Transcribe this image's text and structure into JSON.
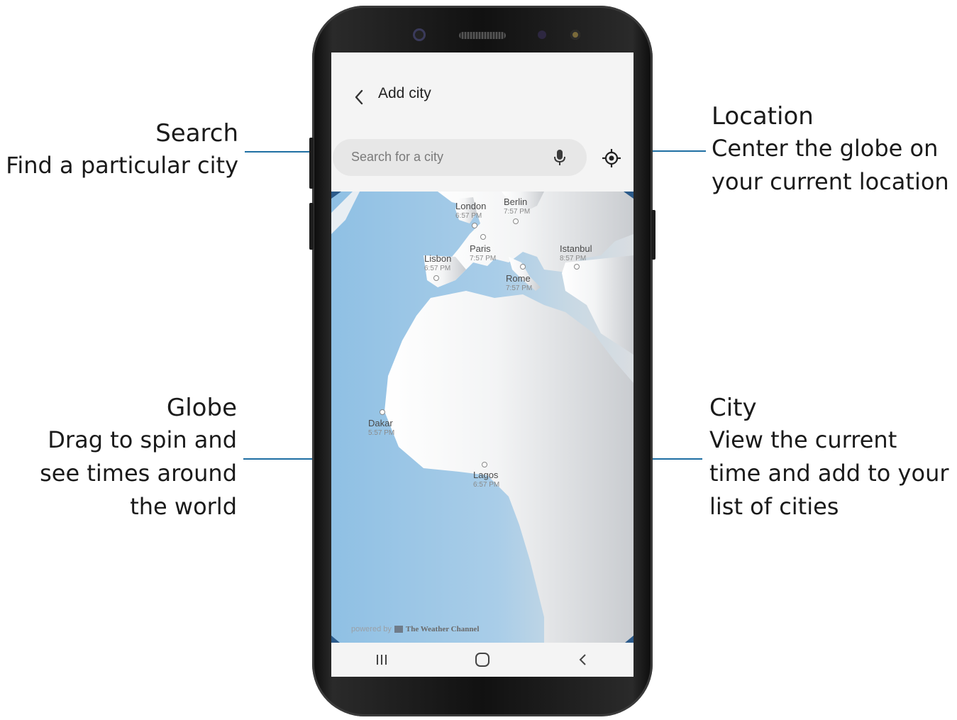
{
  "callouts": {
    "search": {
      "title": "Search",
      "description": "Find a particular city"
    },
    "location": {
      "title": "Location",
      "description_lines": [
        "Center the globe on",
        "your current location"
      ]
    },
    "globe": {
      "title": "Globe",
      "description_lines": [
        "Drag to spin and",
        "see times around",
        "the world"
      ]
    },
    "city": {
      "title": "City",
      "description_lines": [
        "View the current",
        "time and add to your",
        "list of cities"
      ]
    }
  },
  "app": {
    "title": "Add city",
    "search_placeholder": "Search for a city",
    "attribution_prefix": "powered by",
    "attribution_brand": "The Weather Channel"
  },
  "cities": [
    {
      "name": "London",
      "time": "6:57 PM"
    },
    {
      "name": "Berlin",
      "time": "7:57 PM"
    },
    {
      "name": "Paris",
      "time": "7:57 PM"
    },
    {
      "name": "Lisbon",
      "time": "6:57 PM"
    },
    {
      "name": "Istanbul",
      "time": "8:57 PM"
    },
    {
      "name": "Rome",
      "time": "7:57 PM"
    },
    {
      "name": "Dakar",
      "time": "5:57 PM"
    },
    {
      "name": "Lagos",
      "time": "6:57 PM"
    }
  ],
  "colors": {
    "leader_line": "#1f6fa3",
    "ocean": "#9cc6e6",
    "land": "#e8eaec"
  },
  "icons": {
    "back": "chevron-left-icon",
    "mic": "microphone-icon",
    "location": "crosshair-location-icon",
    "recents": "recent-apps-icon",
    "home": "home-icon",
    "nav_back": "back-icon"
  }
}
